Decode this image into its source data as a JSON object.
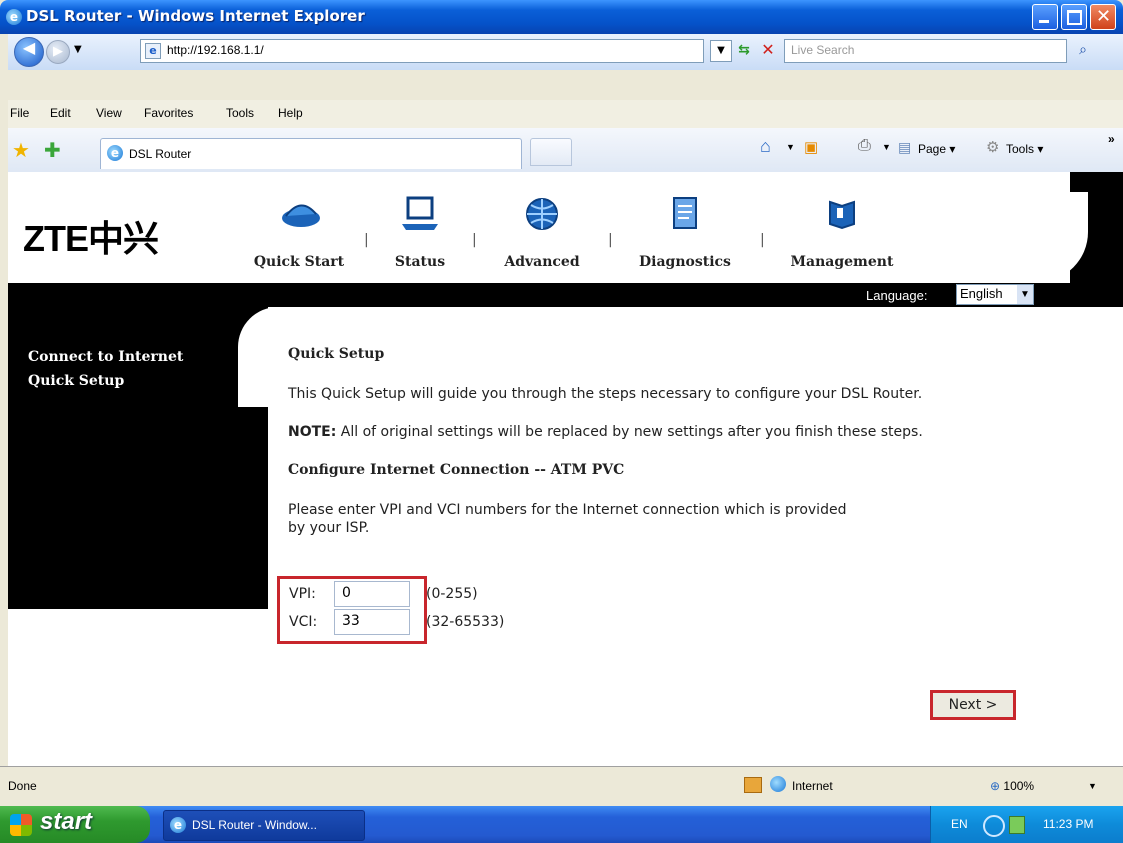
{
  "window": {
    "title": "DSL Router - Windows Internet Explorer"
  },
  "browser": {
    "address": "http://192.168.1.1/",
    "search_placeholder": "Live Search",
    "menus": [
      "File",
      "Edit",
      "View",
      "Favorites",
      "Tools",
      "Help"
    ],
    "tab_title": "DSL Router",
    "toolbar": {
      "page_label": "Page",
      "tools_label": "Tools"
    }
  },
  "router": {
    "logo": "ZTE中兴",
    "nav": [
      {
        "label": "Quick Start",
        "icon": "modem-icon"
      },
      {
        "label": "Status",
        "icon": "laptop-icon"
      },
      {
        "label": "Advanced",
        "icon": "globe-icon"
      },
      {
        "label": "Diagnostics",
        "icon": "clipboard-icon"
      },
      {
        "label": "Management",
        "icon": "book-icon"
      }
    ],
    "language_label": "Language:",
    "language_value": "English",
    "sidebar": [
      "Connect to Internet",
      "Quick Setup"
    ],
    "heading": "Quick Setup",
    "intro": "This Quick Setup will guide you through the steps necessary to configure your DSL Router.",
    "note_label": "NOTE:",
    "note_text": "All of original settings will be replaced by new settings after you finish these steps.",
    "section_title": "Configure Internet Connection -- ATM PVC",
    "instructions_line1": "Please enter VPI and VCI numbers for the Internet connection which is provided",
    "instructions_line2": "by your ISP.",
    "vpi": {
      "label": "VPI:",
      "value": "0",
      "range": "(0-255)"
    },
    "vci": {
      "label": "VCI:",
      "value": "33",
      "range": "(32-65533)"
    },
    "next_label": "Next >"
  },
  "statusbar": {
    "status": "Done",
    "zone": "Internet",
    "zoom": "100%"
  },
  "taskbar": {
    "start": "start",
    "task_item": "DSL Router - Window...",
    "lang": "EN",
    "clock": "11:23 PM"
  },
  "colors": {
    "highlight_border": "#c8262c",
    "title_blue": "#0552c9",
    "sidebar_bg": "#000000"
  }
}
